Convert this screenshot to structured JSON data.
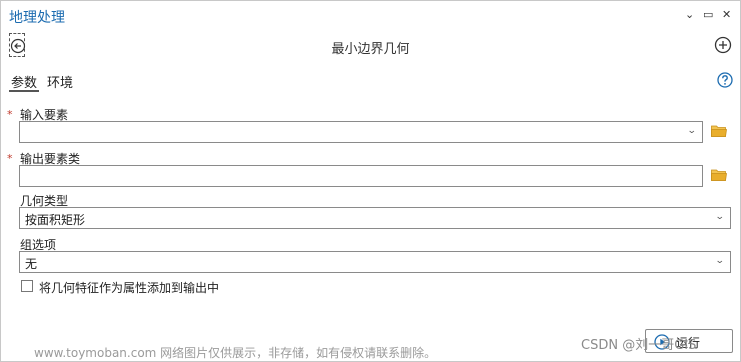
{
  "pane": {
    "title": "地理处理"
  },
  "window_controls": {
    "menu_glyph": "⌄",
    "restore_glyph": "▭",
    "close_glyph": "✕"
  },
  "tool": {
    "title": "最小边界几何"
  },
  "tabs": [
    {
      "label": "参数",
      "active": true
    },
    {
      "label": "环境",
      "active": false
    }
  ],
  "params": {
    "input_features": {
      "label": "输入要素",
      "required": true,
      "value": ""
    },
    "output_feature_class": {
      "label": "输出要素类",
      "required": true,
      "value": ""
    },
    "geometry_type": {
      "label": "几何类型",
      "value": "按面积矩形"
    },
    "group_option": {
      "label": "组选项",
      "value": "无"
    },
    "add_attributes": {
      "label": "将几何特征作为属性添加到输出中",
      "checked": false
    }
  },
  "required_marker": "*",
  "dropdown_caret": "⌄",
  "run": {
    "label": "运行"
  },
  "footer": {
    "watermark": "www.toymoban.com 网络图片仅供展示，非存储，如有侵权请联系删除。"
  },
  "credit": {
    "text": "CSDN @刘一哥GIS"
  },
  "icons": {
    "back": "back-arrow-icon",
    "add": "add-circle-icon",
    "help": "help-icon",
    "folder": "folder-icon",
    "run": "run-play-icon"
  },
  "colors": {
    "accent": "#1b6bb0",
    "required": "#c0392b",
    "folder": "#e0a21c"
  }
}
